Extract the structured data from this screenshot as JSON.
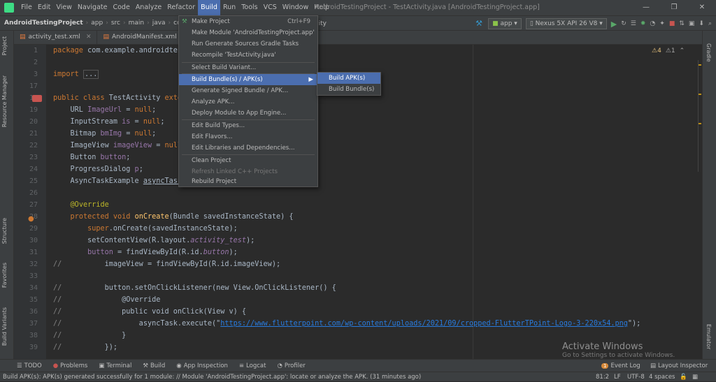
{
  "menubar": {
    "items": [
      "File",
      "Edit",
      "View",
      "Navigate",
      "Code",
      "Analyze",
      "Refactor",
      "Build",
      "Run",
      "Tools",
      "VCS",
      "Window",
      "Help"
    ],
    "title": "AndroidTestingProject - TestActivity.java [AndroidTestingProject.app]"
  },
  "nav": {
    "crumbs": [
      "AndroidTestingProject",
      "app",
      "src",
      "main",
      "java",
      "com"
    ],
    "config": "TestActivity",
    "module": "app",
    "device": "Nexus 5X API 26 V8"
  },
  "tabs": [
    "activity_test.xml",
    "AndroidManifest.xml"
  ],
  "build_menu": {
    "items": [
      {
        "label": "Make Project",
        "shortcut": "Ctrl+F9"
      },
      {
        "label": "Make Module 'AndroidTestingProject.app'"
      },
      {
        "label": "Run Generate Sources Gradle Tasks"
      },
      {
        "label": "Recompile 'TestActivity.java'"
      },
      {
        "label": "Select Build Variant..."
      },
      {
        "label": "Build Bundle(s) / APK(s)"
      },
      {
        "label": "Generate Signed Bundle / APK..."
      },
      {
        "label": "Analyze APK..."
      },
      {
        "label": "Deploy Module to App Engine..."
      },
      {
        "label": "Edit Build Types..."
      },
      {
        "label": "Edit Flavors..."
      },
      {
        "label": "Edit Libraries and Dependencies..."
      },
      {
        "label": "Clean Project"
      },
      {
        "label": "Refresh Linked C++ Projects"
      },
      {
        "label": "Rebuild Project"
      }
    ]
  },
  "submenu": {
    "items": [
      "Build APK(s)",
      "Build Bundle(s)"
    ]
  },
  "inspections": {
    "warnings": "4",
    "errors": "1"
  },
  "line_numbers": [
    "1",
    "2",
    "3",
    "17",
    "18",
    "19",
    "20",
    "21",
    "22",
    "23",
    "24",
    "25",
    "26",
    "27",
    "28",
    "29",
    "30",
    "31",
    "32",
    "33",
    "34",
    "35",
    "36",
    "37",
    "38",
    "39"
  ],
  "code": {
    "pkg": "package com.example.androidtes",
    "import": "import ...",
    "cls_a": "public class ",
    "cls_b": "TestActivity exte",
    "f1a": "URL ",
    "f1b": "ImageUrl",
    " f1c": " = null;",
    "override": "@Override",
    "oncreate": "onCreate",
    "url": "https://www.flutterpoint.com/wp-content/uploads/2021/09/cropped-FlutterTPoint-Logo-3-220x54.png"
  },
  "toolwindows": [
    "TODO",
    "Problems",
    "Terminal",
    "Build",
    "App Inspection",
    "Logcat",
    "Profiler",
    "Event Log",
    "Layout Inspector"
  ],
  "event_count": "1",
  "status": {
    "message": "Build APK(s): APK(s) generated successfully for 1 module: // Module 'AndroidTestingProject.app': locate or analyze the APK. (31 minutes ago)",
    "pos": "81:2",
    "le": "LF",
    "enc": "UTF-8",
    "indent": "4 spaces"
  },
  "left_strip": [
    "Project",
    "Resource Manager",
    "Structure",
    "Favorites",
    "Build Variants"
  ],
  "right_strip": [
    "Gradle",
    "Emulator"
  ],
  "watermark": {
    "line1": "Activate Windows",
    "line2": "Go to Settings to activate Windows."
  }
}
